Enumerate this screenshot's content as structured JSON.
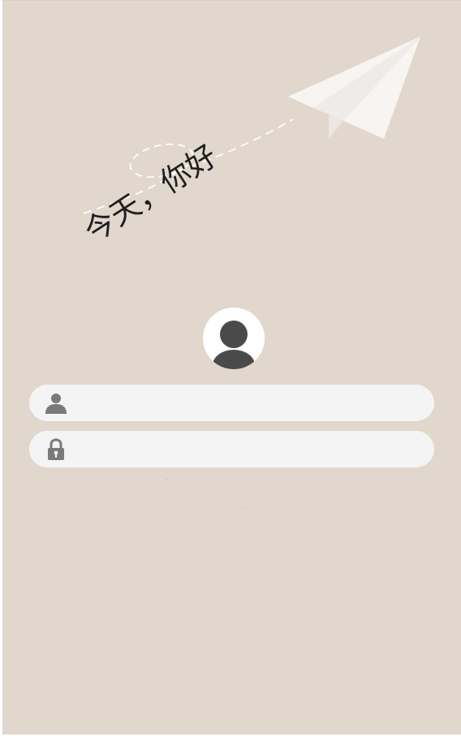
{
  "greeting": {
    "text": "今天，你好"
  },
  "decoration": {
    "plane_icon": "paper-plane-icon",
    "plane_color": "#f7f4f2",
    "trail_color": "#ffffff"
  },
  "avatar": {
    "icon": "user-silhouette-icon",
    "color": "#4a4a4a"
  },
  "login_form": {
    "username": {
      "icon": "user-icon",
      "value": "",
      "placeholder": ""
    },
    "password": {
      "icon": "lock-icon",
      "value": "",
      "placeholder": ""
    }
  },
  "colors": {
    "background": "#e1d7cd",
    "field_background": "#f4f4f4",
    "icon_gray": "#7a7a7a"
  }
}
